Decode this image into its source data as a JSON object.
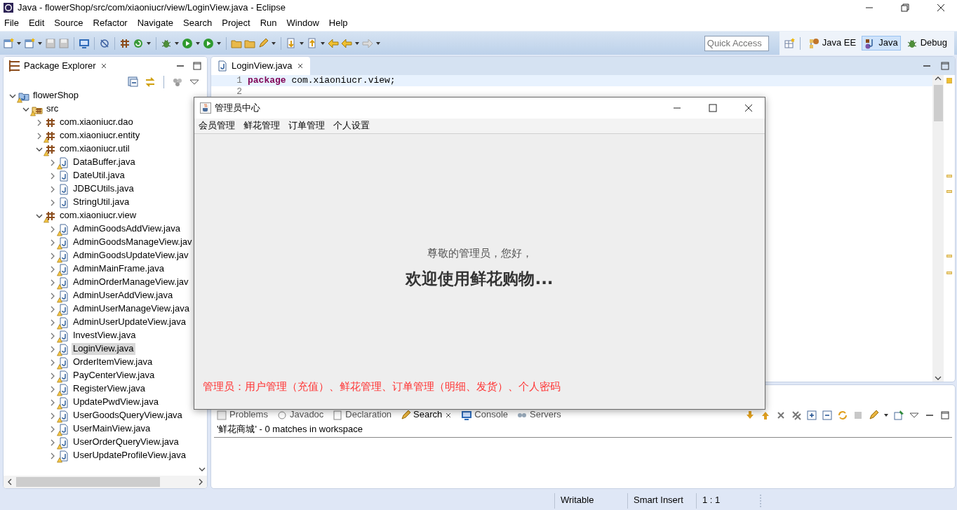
{
  "window": {
    "title": "Java - flowerShop/src/com/xiaoniucr/view/LoginView.java - Eclipse"
  },
  "menu": [
    "File",
    "Edit",
    "Source",
    "Refactor",
    "Navigate",
    "Search",
    "Project",
    "Run",
    "Window",
    "Help"
  ],
  "quick_access": {
    "placeholder": "Quick Access"
  },
  "perspectives": [
    {
      "label": "Java EE",
      "selected": false
    },
    {
      "label": "Java",
      "selected": true
    },
    {
      "label": "Debug",
      "selected": false
    }
  ],
  "package_explorer": {
    "title": "Package Explorer",
    "tree": [
      {
        "label": "flowerShop",
        "kind": "project",
        "warning": true,
        "expanded": true,
        "selected": false,
        "children": [
          {
            "label": "src",
            "kind": "source",
            "warning": true,
            "expanded": true,
            "selected": false,
            "children": [
              {
                "label": "com.xiaoniucr.dao",
                "kind": "package",
                "warning": false,
                "expanded": false,
                "selected": false
              },
              {
                "label": "com.xiaoniucr.entity",
                "kind": "package",
                "warning": true,
                "expanded": false,
                "selected": false
              },
              {
                "label": "com.xiaoniucr.util",
                "kind": "package",
                "warning": true,
                "expanded": true,
                "selected": false,
                "children": [
                  {
                    "label": "DataBuffer.java",
                    "kind": "file",
                    "warning": true,
                    "expanded": false,
                    "selected": false
                  },
                  {
                    "label": "DateUtil.java",
                    "kind": "file",
                    "warning": false,
                    "expanded": false,
                    "selected": false
                  },
                  {
                    "label": "JDBCUtils.java",
                    "kind": "file",
                    "warning": false,
                    "expanded": false,
                    "selected": false
                  },
                  {
                    "label": "StringUtil.java",
                    "kind": "file",
                    "warning": false,
                    "expanded": false,
                    "selected": false
                  }
                ]
              },
              {
                "label": "com.xiaoniucr.view",
                "kind": "package",
                "warning": true,
                "expanded": true,
                "selected": false,
                "children": [
                  {
                    "label": "AdminGoodsAddView.java",
                    "kind": "file",
                    "warning": true,
                    "expanded": false,
                    "selected": false
                  },
                  {
                    "label": "AdminGoodsManageView.jav",
                    "kind": "file",
                    "warning": true,
                    "expanded": false,
                    "selected": false
                  },
                  {
                    "label": "AdminGoodsUpdateView.jav",
                    "kind": "file",
                    "warning": true,
                    "expanded": false,
                    "selected": false
                  },
                  {
                    "label": "AdminMainFrame.java",
                    "kind": "file",
                    "warning": true,
                    "expanded": false,
                    "selected": false
                  },
                  {
                    "label": "AdminOrderManageView.jav",
                    "kind": "file",
                    "warning": true,
                    "expanded": false,
                    "selected": false
                  },
                  {
                    "label": "AdminUserAddView.java",
                    "kind": "file",
                    "warning": true,
                    "expanded": false,
                    "selected": false
                  },
                  {
                    "label": "AdminUserManageView.java",
                    "kind": "file",
                    "warning": true,
                    "expanded": false,
                    "selected": false
                  },
                  {
                    "label": "AdminUserUpdateView.java",
                    "kind": "file",
                    "warning": true,
                    "expanded": false,
                    "selected": false
                  },
                  {
                    "label": "InvestView.java",
                    "kind": "file",
                    "warning": true,
                    "expanded": false,
                    "selected": false
                  },
                  {
                    "label": "LoginView.java",
                    "kind": "file",
                    "warning": true,
                    "expanded": false,
                    "selected": true
                  },
                  {
                    "label": "OrderItemView.java",
                    "kind": "file",
                    "warning": true,
                    "expanded": false,
                    "selected": false
                  },
                  {
                    "label": "PayCenterView.java",
                    "kind": "file",
                    "warning": true,
                    "expanded": false,
                    "selected": false
                  },
                  {
                    "label": "RegisterView.java",
                    "kind": "file",
                    "warning": true,
                    "expanded": false,
                    "selected": false
                  },
                  {
                    "label": "UpdatePwdView.java",
                    "kind": "file",
                    "warning": true,
                    "expanded": false,
                    "selected": false
                  },
                  {
                    "label": "UserGoodsQueryView.java",
                    "kind": "file",
                    "warning": true,
                    "expanded": false,
                    "selected": false
                  },
                  {
                    "label": "UserMainView.java",
                    "kind": "file",
                    "warning": true,
                    "expanded": false,
                    "selected": false
                  },
                  {
                    "label": "UserOrderQueryView.java",
                    "kind": "file",
                    "warning": true,
                    "expanded": false,
                    "selected": false
                  },
                  {
                    "label": "UserUpdateProfileView.java",
                    "kind": "file",
                    "warning": true,
                    "expanded": false,
                    "selected": false
                  }
                ]
              }
            ]
          }
        ]
      }
    ]
  },
  "editor": {
    "tab": "LoginView.java",
    "lines": [
      {
        "number": "1",
        "keyword": "package",
        "code": " com.xiaoniucr.view;",
        "current": true
      },
      {
        "number": "2",
        "current": false
      }
    ]
  },
  "dialog": {
    "title": "管理员中心",
    "menu": [
      "会员管理",
      "鲜花管理",
      "订单管理",
      "个人设置"
    ],
    "greeting": "尊敬的管理员，您好，",
    "welcome": "欢迎使用鲜花购物...",
    "footer": "管理员：用户管理（充值）、鲜花管理、订单管理（明细、发货）、个人密码"
  },
  "bottom_panel": {
    "tabs": [
      {
        "label": "Problems",
        "selected": false
      },
      {
        "label": "Javadoc",
        "selected": false
      },
      {
        "label": "Declaration",
        "selected": false
      },
      {
        "label": "Search",
        "selected": true
      },
      {
        "label": "Console",
        "selected": false
      },
      {
        "label": "Servers",
        "selected": false
      }
    ],
    "result": "'鲜花商城' - 0 matches in workspace"
  },
  "status_bar": [
    "Writable",
    "Smart Insert",
    "1 : 1"
  ]
}
